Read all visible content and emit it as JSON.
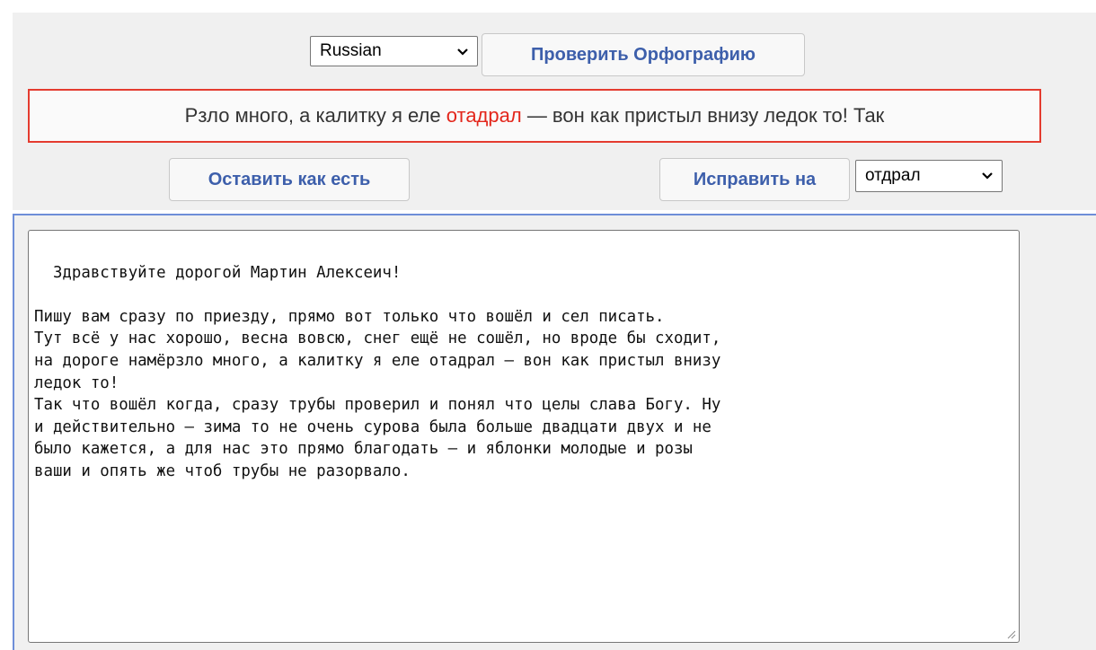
{
  "toolbar": {
    "language_selected": "Russian",
    "check_button_label": "Проверить Орфографию"
  },
  "context": {
    "before": "Рзло много, а калитку я еле ",
    "misspelled": "отадрал",
    "after": " — вон как пристыл внизу ледок то! Так"
  },
  "actions": {
    "keep_button_label": "Оставить как есть",
    "fix_button_label": "Исправить на",
    "suggestion_selected": "отдрал"
  },
  "editor": {
    "text": "Здравствуйте дорогой Мартин Алексеич!\n\nПишу вам сразу по приезду, прямо вот только что вошёл и сел писать.\nТут всё у нас хорошо, весна вовсю, снег ещё не сошёл, но вроде бы сходит,\nна дороге намёрзло много, а калитку я еле отадрал — вон как пристыл внизу\nледок то!\nТак что вошёл когда, сразу трубы проверил и понял что целы слава Богу. Ну\nи действительно — зима то не очень сурова была больше двадцати двух и не\nбыло кажется, а для нас это прямо благодать — и яблонки молодые и розы\nваши и опять же чтоб трубы не разорвало."
  },
  "colors": {
    "panel_bg": "#f0f0f0",
    "button_text": "#3d5fab",
    "error_border": "#e43b2f",
    "misspelled_text": "#e3261b",
    "editor_focus_border": "#6e8ed8"
  },
  "icons": {
    "dropdown": "chevron-down-icon",
    "resize": "resize-grip-icon"
  }
}
